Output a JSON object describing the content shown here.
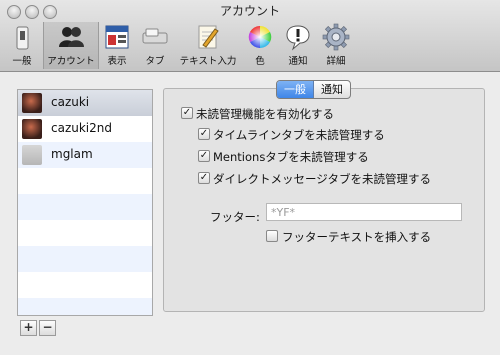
{
  "window": {
    "title": "アカウント"
  },
  "toolbar": {
    "items": [
      {
        "label": "一般",
        "icon": "switch-icon"
      },
      {
        "label": "アカウント",
        "icon": "people-icon",
        "selected": true
      },
      {
        "label": "表示",
        "icon": "display-icon"
      },
      {
        "label": "タブ",
        "icon": "tab-icon"
      },
      {
        "label": "テキスト入力",
        "icon": "pencil-icon"
      },
      {
        "label": "色",
        "icon": "color-wheel-icon"
      },
      {
        "label": "通知",
        "icon": "notification-icon"
      },
      {
        "label": "詳細",
        "icon": "gear-icon"
      }
    ]
  },
  "accounts": {
    "items": [
      {
        "name": "cazuki",
        "selected": true
      },
      {
        "name": "cazuki2nd",
        "selected": false
      },
      {
        "name": "mglam",
        "selected": false
      }
    ],
    "add_label": "+",
    "remove_label": "−"
  },
  "tabs": [
    {
      "label": "一般",
      "active": true
    },
    {
      "label": "通知",
      "active": false
    }
  ],
  "options": {
    "unread_enable": {
      "label": "未読管理機能を有効化する",
      "checked": true
    },
    "timeline": {
      "label": "タイムラインタブを未読管理する",
      "checked": true
    },
    "mentions": {
      "label": "Mentionsタブを未読管理する",
      "checked": true
    },
    "direct": {
      "label": "ダイレクトメッセージタブを未読管理する",
      "checked": true
    }
  },
  "footer": {
    "label": "フッター:",
    "placeholder": "*YF*",
    "insert_label": "フッターテキストを挿入する",
    "insert_checked": false
  }
}
